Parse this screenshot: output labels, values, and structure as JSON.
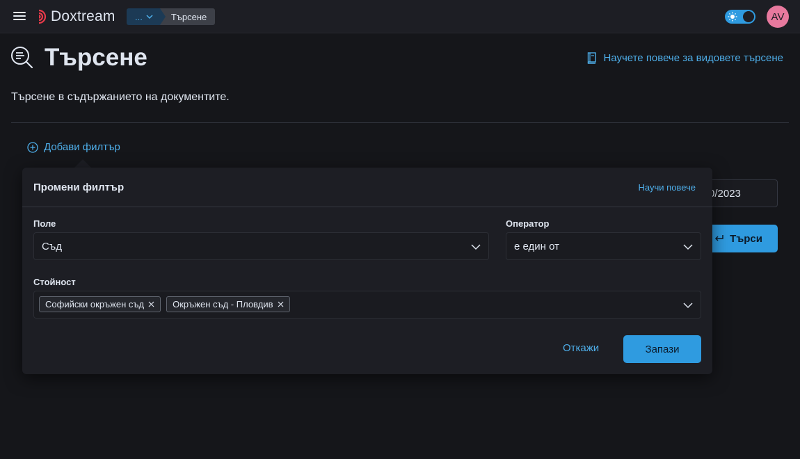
{
  "header": {
    "app_name": "Doxtream",
    "breadcrumb_more": "...",
    "breadcrumb_current": "Търсене",
    "avatar_initials": "AV",
    "theme_toggle_state": "light-on",
    "accent_color": "#2f9be0"
  },
  "page": {
    "title": "Търсене",
    "description": "Търсене в съдържанието на документите.",
    "learn_more_link": "Научете повече за видовете търсене",
    "add_filter_label": "Добави филтър",
    "date_field_value": "0/2023",
    "search_button_label": "Търси"
  },
  "filter_popover": {
    "title": "Промени филтър",
    "learn_more": "Научи повече",
    "field_label": "Поле",
    "field_value": "Съд",
    "operator_label": "Оператор",
    "operator_value": "е един от",
    "value_label": "Стойност",
    "selected_values": [
      "Софийски окръжен съд",
      "Окръжен съд - Пловдив"
    ],
    "cancel_label": "Откажи",
    "save_label": "Запази"
  },
  "icons": {
    "menu": "hamburger-icon",
    "logo": "doxtream-logo",
    "search_page": "search-page-icon",
    "docs": "book-icon",
    "add": "plus-circle-icon",
    "enter": "enter-icon",
    "chevron": "chevron-down-icon",
    "remove": "close-icon"
  }
}
